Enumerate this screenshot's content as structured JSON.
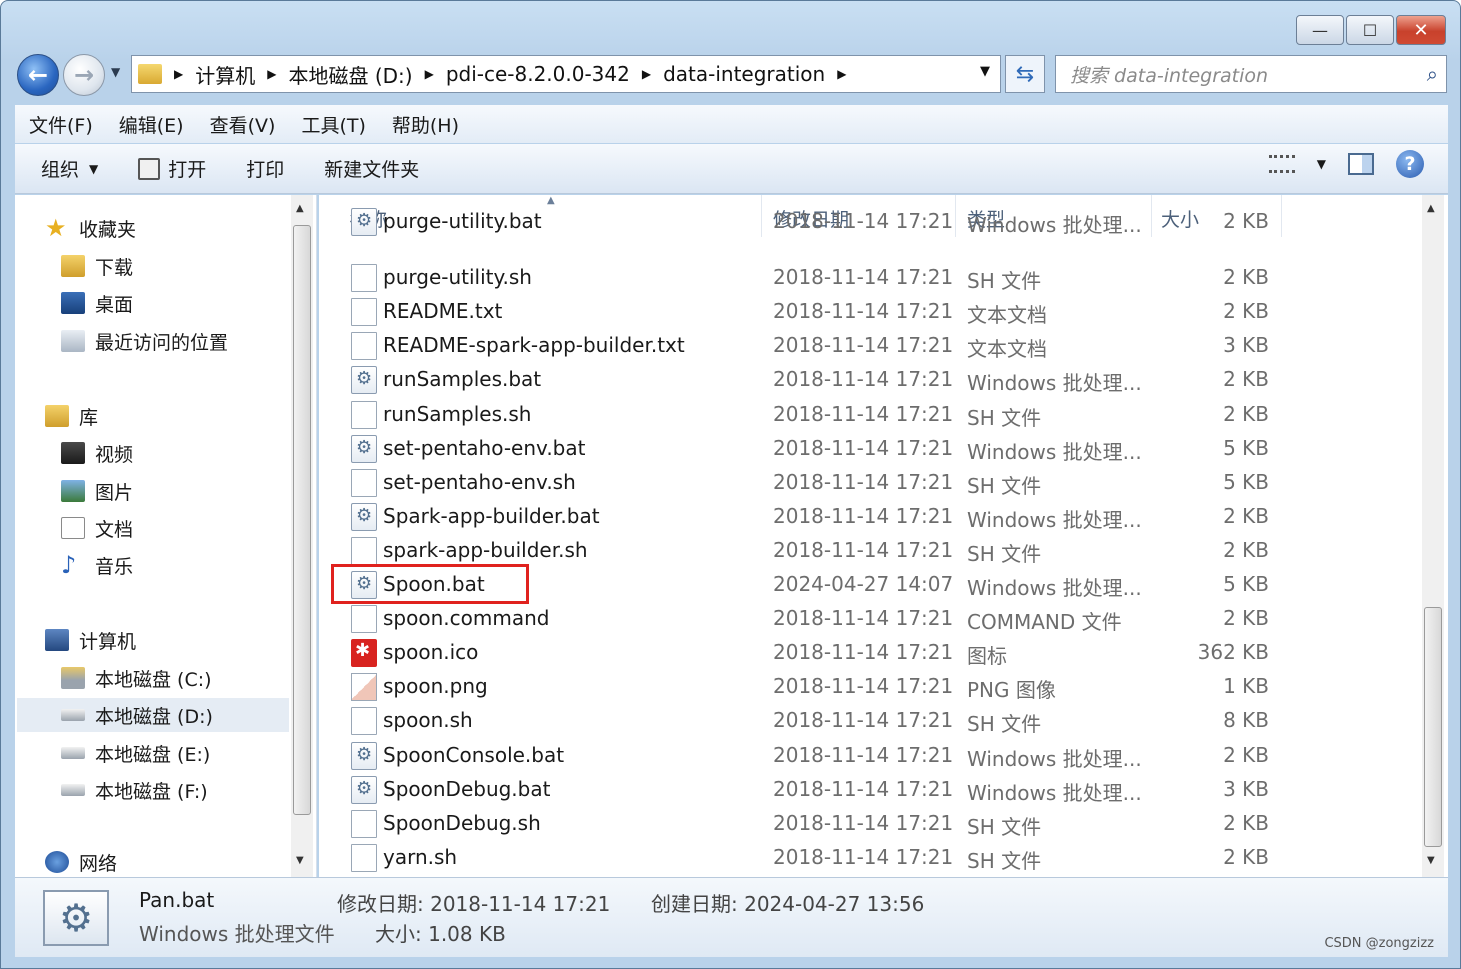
{
  "window": {
    "caption_buttons": {
      "minimize": "—",
      "maximize": "☐",
      "close": "✕"
    }
  },
  "address": {
    "crumbs": [
      "计算机",
      "本地磁盘 (D:)",
      "pdi-ce-8.2.0.0-342",
      "data-integration"
    ],
    "separator": "▶",
    "dropdown": "▼",
    "search_placeholder": "搜索 data-integration"
  },
  "menu": [
    "文件(F)",
    "编辑(E)",
    "查看(V)",
    "工具(T)",
    "帮助(H)"
  ],
  "commands": {
    "organize": "组织",
    "open": "打开",
    "print": "打印",
    "new_folder": "新建文件夹"
  },
  "nav": {
    "favorites": "收藏夹",
    "downloads": "下载",
    "desktop": "桌面",
    "recent": "最近访问的位置",
    "libraries": "库",
    "videos": "视频",
    "pictures": "图片",
    "documents": "文档",
    "music": "音乐",
    "computer": "计算机",
    "drive_c": "本地磁盘 (C:)",
    "drive_d": "本地磁盘 (D:)",
    "drive_e": "本地磁盘 (E:)",
    "drive_f": "本地磁盘 (F:)",
    "network": "网络"
  },
  "columns": {
    "name": "名称",
    "date": "修改日期",
    "type": "类型",
    "size": "大小"
  },
  "files": [
    {
      "name": "purge-utility.bat",
      "date": "2018-11-14 17:21",
      "type": "Windows 批处理...",
      "size": "2 KB",
      "icon": "bat"
    },
    {
      "name": "purge-utility.sh",
      "date": "2018-11-14 17:21",
      "type": "SH 文件",
      "size": "2 KB",
      "icon": "doc"
    },
    {
      "name": "README.txt",
      "date": "2018-11-14 17:21",
      "type": "文本文档",
      "size": "2 KB",
      "icon": "doc"
    },
    {
      "name": "README-spark-app-builder.txt",
      "date": "2018-11-14 17:21",
      "type": "文本文档",
      "size": "3 KB",
      "icon": "doc"
    },
    {
      "name": "runSamples.bat",
      "date": "2018-11-14 17:21",
      "type": "Windows 批处理...",
      "size": "2 KB",
      "icon": "bat"
    },
    {
      "name": "runSamples.sh",
      "date": "2018-11-14 17:21",
      "type": "SH 文件",
      "size": "2 KB",
      "icon": "doc"
    },
    {
      "name": "set-pentaho-env.bat",
      "date": "2018-11-14 17:21",
      "type": "Windows 批处理...",
      "size": "5 KB",
      "icon": "bat"
    },
    {
      "name": "set-pentaho-env.sh",
      "date": "2018-11-14 17:21",
      "type": "SH 文件",
      "size": "5 KB",
      "icon": "doc"
    },
    {
      "name": "Spark-app-builder.bat",
      "date": "2018-11-14 17:21",
      "type": "Windows 批处理...",
      "size": "2 KB",
      "icon": "bat"
    },
    {
      "name": "spark-app-builder.sh",
      "date": "2018-11-14 17:21",
      "type": "SH 文件",
      "size": "2 KB",
      "icon": "doc"
    },
    {
      "name": "Spoon.bat",
      "date": "2024-04-27 14:07",
      "type": "Windows 批处理...",
      "size": "5 KB",
      "icon": "bat"
    },
    {
      "name": "spoon.command",
      "date": "2018-11-14 17:21",
      "type": "COMMAND 文件",
      "size": "2 KB",
      "icon": "doc"
    },
    {
      "name": "spoon.ico",
      "date": "2018-11-14 17:21",
      "type": "图标",
      "size": "362 KB",
      "icon": "ico"
    },
    {
      "name": "spoon.png",
      "date": "2018-11-14 17:21",
      "type": "PNG 图像",
      "size": "1 KB",
      "icon": "png"
    },
    {
      "name": "spoon.sh",
      "date": "2018-11-14 17:21",
      "type": "SH 文件",
      "size": "8 KB",
      "icon": "doc"
    },
    {
      "name": "SpoonConsole.bat",
      "date": "2018-11-14 17:21",
      "type": "Windows 批处理...",
      "size": "2 KB",
      "icon": "bat"
    },
    {
      "name": "SpoonDebug.bat",
      "date": "2018-11-14 17:21",
      "type": "Windows 批处理...",
      "size": "3 KB",
      "icon": "bat"
    },
    {
      "name": "SpoonDebug.sh",
      "date": "2018-11-14 17:21",
      "type": "SH 文件",
      "size": "2 KB",
      "icon": "doc"
    },
    {
      "name": "yarn.sh",
      "date": "2018-11-14 17:21",
      "type": "SH 文件",
      "size": "2 KB",
      "icon": "doc"
    }
  ],
  "details": {
    "name": "Pan.bat",
    "type": "Windows 批处理文件",
    "modified": "修改日期: 2018-11-14 17:21",
    "size": "大小: 1.08 KB",
    "created": "创建日期: 2024-04-27 13:56"
  },
  "watermark": "CSDN @zongzizz"
}
